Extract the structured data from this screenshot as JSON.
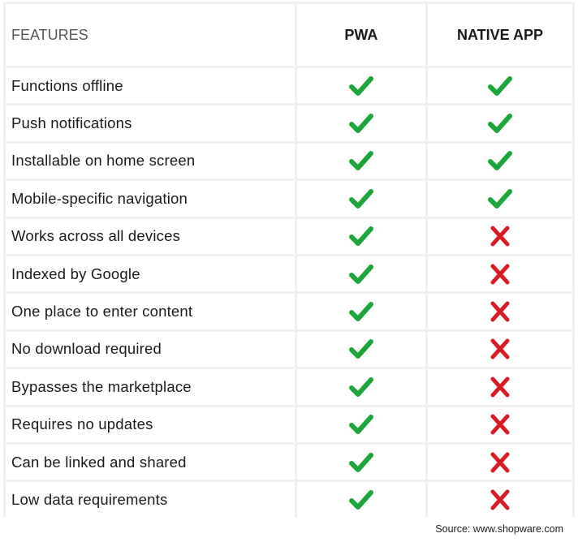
{
  "colors": {
    "check": "#1da63a",
    "cross": "#d91b24"
  },
  "header": {
    "features": "FEATURES",
    "pwa": "PWA",
    "native": "NATIVE APP"
  },
  "rows": [
    {
      "feature": "Functions offline",
      "pwa": "check-icon",
      "native": "check-icon"
    },
    {
      "feature": "Push notifications",
      "pwa": "check-icon",
      "native": "check-icon"
    },
    {
      "feature": "Installable on home screen",
      "pwa": "check-icon",
      "native": "check-icon"
    },
    {
      "feature": "Mobile-specific navigation",
      "pwa": "check-icon",
      "native": "check-icon"
    },
    {
      "feature": "Works across all devices",
      "pwa": "check-icon",
      "native": "cross-icon"
    },
    {
      "feature": "Indexed by Google",
      "pwa": "check-icon",
      "native": "cross-icon"
    },
    {
      "feature": "One place to enter content",
      "pwa": "check-icon",
      "native": "cross-icon"
    },
    {
      "feature": "No download required",
      "pwa": "check-icon",
      "native": "cross-icon"
    },
    {
      "feature": "Bypasses the marketplace",
      "pwa": "check-icon",
      "native": "cross-icon"
    },
    {
      "feature": "Requires no updates",
      "pwa": "check-icon",
      "native": "cross-icon"
    },
    {
      "feature": "Can be linked and shared",
      "pwa": "check-icon",
      "native": "cross-icon"
    },
    {
      "feature": "Low data requirements",
      "pwa": "check-icon",
      "native": "cross-icon"
    }
  ],
  "source": "Source: www.shopware.com"
}
